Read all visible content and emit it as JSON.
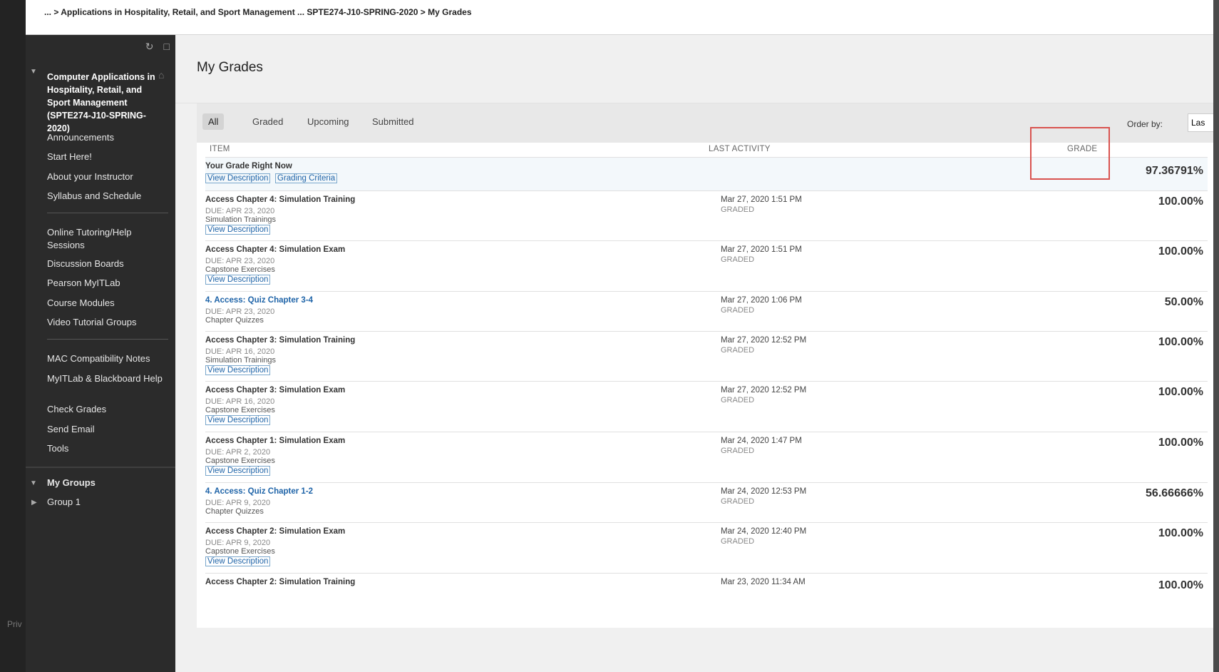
{
  "topbar": {
    "breadcrumb": "... > Applications in Hospitality, Retail, and Sport Management ... SPTE274-J10-SPRING-2020 > My Grades"
  },
  "sidebar": {
    "course_title": "Computer Applications in Hospitality, Retail, and Sport Management (SPTE274-J10-SPRING-2020)",
    "group1": [
      "Announcements",
      "Start Here!",
      "About your Instructor",
      "Syllabus and Schedule"
    ],
    "group2": [
      "Online Tutoring/Help Sessions",
      "Discussion Boards",
      "Pearson MyITLab",
      "Course Modules",
      "Video Tutorial Groups"
    ],
    "group3": [
      "MAC Compatibility Notes",
      "MyITLab & Blackboard Help",
      "Check Grades",
      "Send Email",
      "Tools"
    ],
    "my_groups": "My Groups",
    "group_item": "Group 1"
  },
  "footer": {
    "privacy": "Priv"
  },
  "main": {
    "title": "My Grades",
    "tabs": [
      "All",
      "Graded",
      "Upcoming",
      "Submitted"
    ],
    "order_by_label": "Order by:",
    "order_by_value": "Las",
    "columns": {
      "item": "ITEM",
      "last_activity": "LAST ACTIVITY",
      "grade": "GRADE"
    }
  },
  "rows": [
    {
      "title": "Your Grade Right Now",
      "links": [
        "View Description",
        "Grading Criteria"
      ],
      "grade": "97.36791%"
    },
    {
      "title": "Access Chapter 4: Simulation Training",
      "due": "DUE: APR 23, 2020",
      "category": "Simulation Trainings",
      "link": "View Description",
      "date": "Mar 27, 2020 1:51 PM",
      "status": "GRADED",
      "grade": "100.00%"
    },
    {
      "title": "Access Chapter 4: Simulation Exam",
      "due": "DUE: APR 23, 2020",
      "category": "Capstone Exercises",
      "link": "View Description",
      "date": "Mar 27, 2020 1:51 PM",
      "status": "GRADED",
      "grade": "100.00%"
    },
    {
      "title": "4. Access: Quiz Chapter 3-4",
      "due": "DUE: APR 23, 2020",
      "category": "Chapter Quizzes",
      "date": "Mar 27, 2020 1:06 PM",
      "status": "GRADED",
      "grade": "50.00%"
    },
    {
      "title": "Access Chapter 3: Simulation Training",
      "due": "DUE: APR 16, 2020",
      "category": "Simulation Trainings",
      "link": "View Description",
      "date": "Mar 27, 2020 12:52 PM",
      "status": "GRADED",
      "grade": "100.00%"
    },
    {
      "title": "Access Chapter 3: Simulation Exam",
      "due": "DUE: APR 16, 2020",
      "category": "Capstone Exercises",
      "link": "View Description",
      "date": "Mar 27, 2020 12:52 PM",
      "status": "GRADED",
      "grade": "100.00%"
    },
    {
      "title": "Access Chapter 1: Simulation Exam",
      "due": "DUE: APR 2, 2020",
      "category": "Capstone Exercises",
      "link": "View Description",
      "date": "Mar 24, 2020 1:47 PM",
      "status": "GRADED",
      "grade": "100.00%"
    },
    {
      "title": "4. Access: Quiz Chapter 1-2",
      "due": "DUE: APR 9, 2020",
      "category": "Chapter Quizzes",
      "date": "Mar 24, 2020 12:53 PM",
      "status": "GRADED",
      "grade": "56.66666%"
    },
    {
      "title": "Access Chapter 2: Simulation Exam",
      "due": "DUE: APR 9, 2020",
      "category": "Capstone Exercises",
      "link": "View Description",
      "date": "Mar 24, 2020 12:40 PM",
      "status": "GRADED",
      "grade": "100.00%"
    },
    {
      "title": "Access Chapter 2: Simulation Training",
      "date": "Mar 23, 2020 11:34 AM",
      "grade": "100.00%"
    }
  ]
}
